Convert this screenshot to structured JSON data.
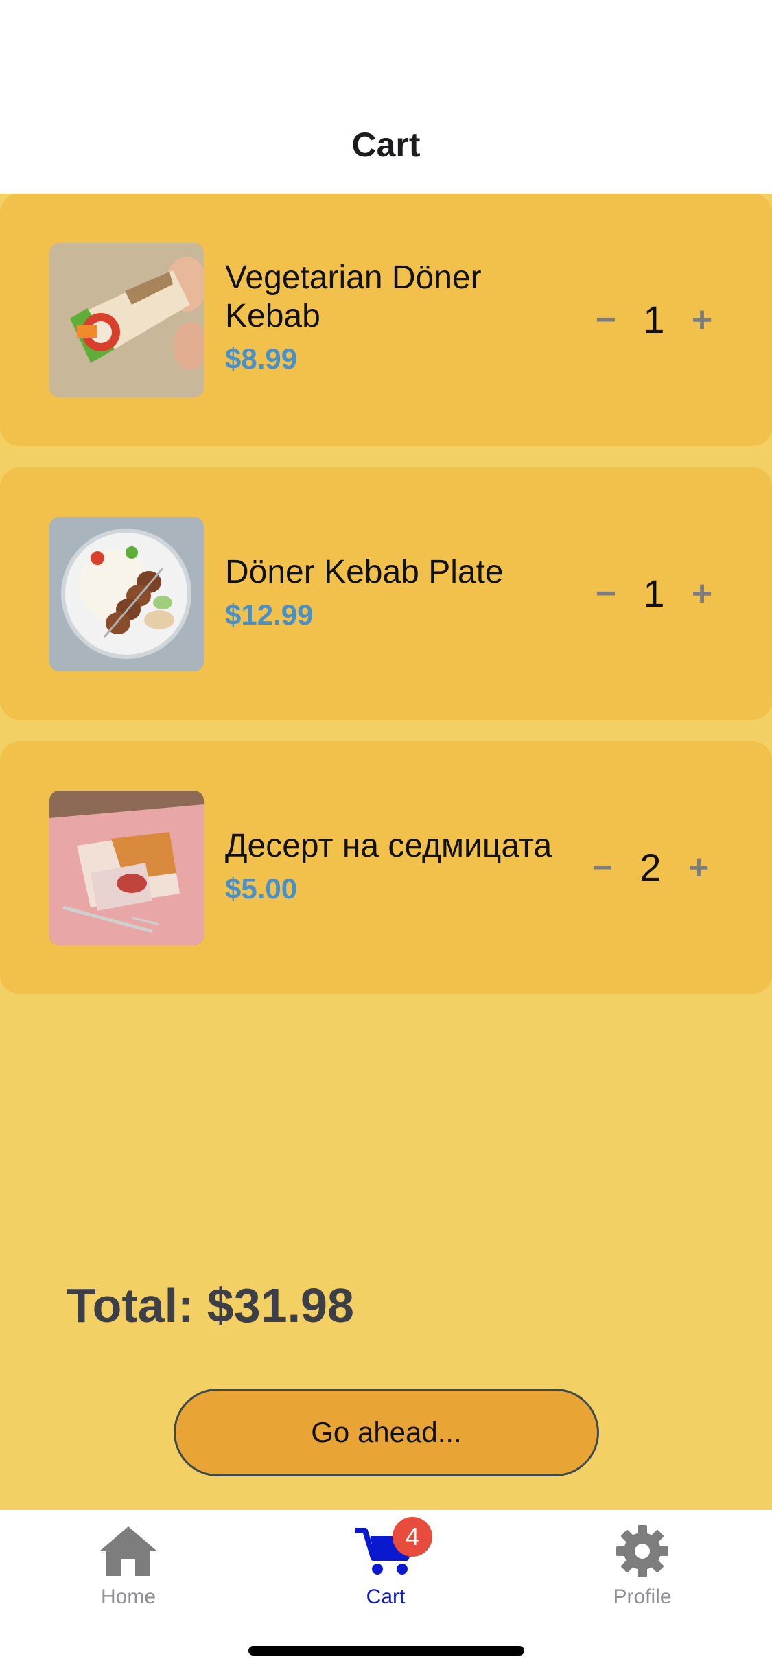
{
  "header": {
    "title": "Cart"
  },
  "cart": {
    "items": [
      {
        "name": "Vegetarian Döner Kebab",
        "price": "$8.99",
        "quantity": "1",
        "image": "veggie-wrap-image"
      },
      {
        "name": "Döner Kebab Plate",
        "price": "$12.99",
        "quantity": "1",
        "image": "kebab-plate-image"
      },
      {
        "name": "Десерт на седмицата",
        "price": "$5.00",
        "quantity": "2",
        "image": "dessert-image"
      }
    ],
    "minus_glyph": "−",
    "plus_glyph": "+",
    "total": "Total: $31.98",
    "go_label": "Go ahead..."
  },
  "tabbar": {
    "tabs": [
      {
        "label": "Home",
        "icon": "home-icon"
      },
      {
        "label": "Cart",
        "icon": "cart-icon",
        "badge": "4",
        "active": true
      },
      {
        "label": "Profile",
        "icon": "gear-icon"
      }
    ]
  },
  "colors": {
    "background": "#f3d064",
    "card": "#f1c14b",
    "price": "#4a90c8",
    "button": "#e8a536",
    "active_tab": "#0a19d0",
    "badge": "#e74c3c"
  }
}
